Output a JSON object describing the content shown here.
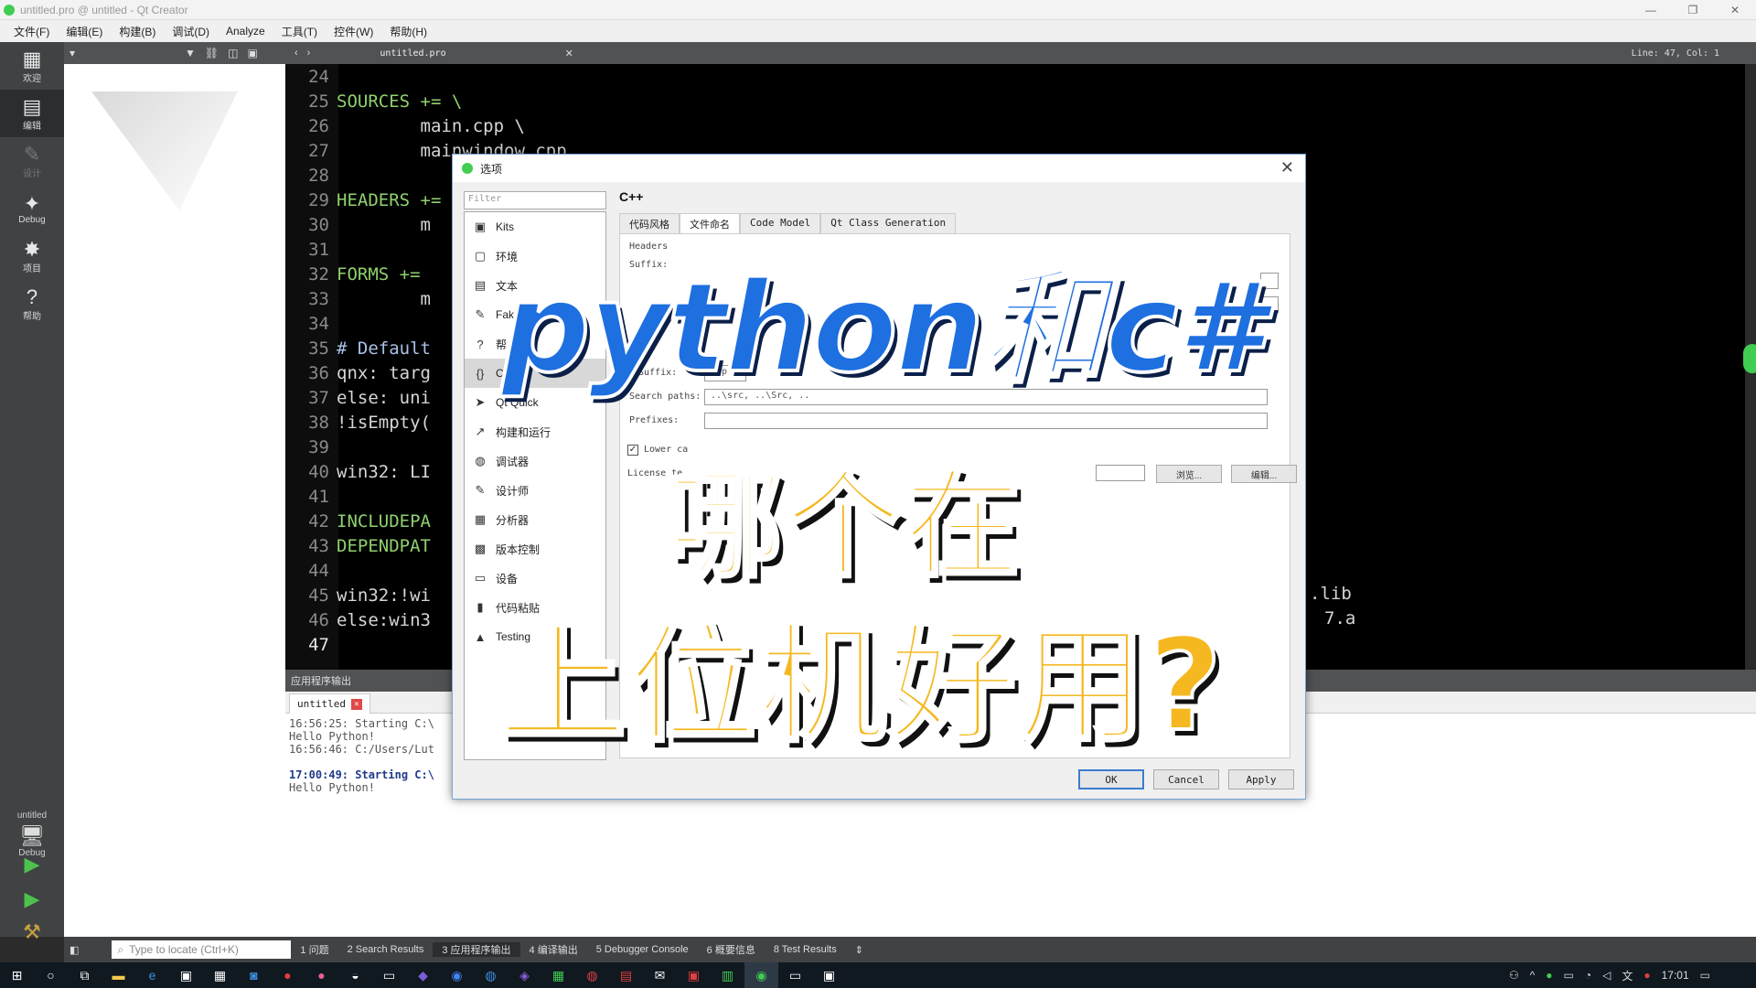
{
  "window": {
    "title": "untitled.pro @ untitled - Qt Creator"
  },
  "menu": [
    "文件(F)",
    "编辑(E)",
    "构建(B)",
    "调试(D)",
    "Analyze",
    "工具(T)",
    "控件(W)",
    "帮助(H)"
  ],
  "modes": [
    {
      "label": "欢迎",
      "icon": "▦"
    },
    {
      "label": "编辑",
      "icon": "▤"
    },
    {
      "label": "设计",
      "icon": "✎"
    },
    {
      "label": "Debug",
      "icon": "✦"
    },
    {
      "label": "项目",
      "icon": "✸"
    },
    {
      "label": "帮助",
      "icon": "?"
    }
  ],
  "kit": {
    "project": "untitled",
    "mode": "Debug"
  },
  "editor": {
    "file_tab": "untitled.pro",
    "cursor": "Line: 47, Col: 1",
    "lines": [
      {
        "n": "24",
        "t": ""
      },
      {
        "n": "25",
        "t": "SOURCES += \\"
      },
      {
        "n": "26",
        "t": "        main.cpp \\"
      },
      {
        "n": "27",
        "t": "        mainwindow.cpp"
      },
      {
        "n": "28",
        "t": ""
      },
      {
        "n": "29",
        "t": "HEADERS +="
      },
      {
        "n": "30",
        "t": "        m"
      },
      {
        "n": "31",
        "t": ""
      },
      {
        "n": "32",
        "t": "FORMS +="
      },
      {
        "n": "33",
        "t": "        m"
      },
      {
        "n": "34",
        "t": ""
      },
      {
        "n": "35",
        "t": "# Default"
      },
      {
        "n": "36",
        "t": "qnx: targ"
      },
      {
        "n": "37",
        "t": "else: uni"
      },
      {
        "n": "38",
        "t": "!isEmpty("
      },
      {
        "n": "39",
        "t": ""
      },
      {
        "n": "40",
        "t": "win32: LI"
      },
      {
        "n": "41",
        "t": ""
      },
      {
        "n": "42",
        "t": "INCLUDEPA"
      },
      {
        "n": "43",
        "t": "DEPENDPAT"
      },
      {
        "n": "44",
        "t": ""
      },
      {
        "n": "45",
        "t": "win32:!wi"
      },
      {
        "n": "46",
        "t": "else:win3"
      },
      {
        "n": "47",
        "t": ""
      }
    ],
    "right_fragments": [
      ".lib",
      "7.a"
    ]
  },
  "output": {
    "header": "应用程序输出",
    "tab": "untitled",
    "lines": [
      {
        "t": "16:56:25: Starting C:\\",
        "bold": false
      },
      {
        "t": "Hello Python!",
        "bold": false
      },
      {
        "t": "16:56:46: C:/Users/Lut",
        "bold": false
      },
      {
        "t": "",
        "bold": false
      },
      {
        "t": "17:00:49: Starting C:\\",
        "bold": true
      },
      {
        "t": "Hello Python!",
        "bold": false
      }
    ]
  },
  "panels": {
    "locate_placeholder": "Type to locate (Ctrl+K)",
    "buttons": [
      "1 问题",
      "2 Search Results",
      "3 应用程序输出",
      "4 编译输出",
      "5 Debugger Console",
      "6 概要信息",
      "8 Test Results"
    ]
  },
  "taskbar": {
    "time": "17:01"
  },
  "dialog": {
    "title": "选项",
    "filter_placeholder": "Filter",
    "heading": "C++",
    "categories": [
      {
        "label": "Kits",
        "icon": "▣"
      },
      {
        "label": "环境",
        "icon": "▢"
      },
      {
        "label": "文本",
        "icon": "▤"
      },
      {
        "label": "Fake",
        "icon": "✎"
      },
      {
        "label": "帮",
        "icon": "?"
      },
      {
        "label": "C",
        "icon": "{}"
      },
      {
        "label": "Qt Quick",
        "icon": "➤"
      },
      {
        "label": "构建和运行",
        "icon": "↗"
      },
      {
        "label": "调试器",
        "icon": "◍"
      },
      {
        "label": "设计师",
        "icon": "✎"
      },
      {
        "label": "分析器",
        "icon": "▦"
      },
      {
        "label": "版本控制",
        "icon": "▩"
      },
      {
        "label": "设备",
        "icon": "▭"
      },
      {
        "label": "代码粘贴",
        "icon": "▮"
      },
      {
        "label": "Testing",
        "icon": "▲"
      }
    ],
    "tabs": [
      "代码风格",
      "文件命名",
      "Code Model",
      "Qt Class Generation"
    ],
    "fields": {
      "headers_group": "Headers",
      "suffix_label": "Suffix:",
      "source_suffix_label": "Suffix:",
      "source_suffix_value": "cpp",
      "search_paths_label": "Search paths:",
      "search_paths_value": "..\\src, ..\\Src, ..",
      "prefixes_label": "Prefixes:",
      "lowercase_label": "Lower ca",
      "license_label": "License te",
      "browse_button": "浏览...",
      "edit_button": "编辑..."
    },
    "buttons": {
      "ok": "OK",
      "cancel": "Cancel",
      "apply": "Apply"
    }
  },
  "headline": {
    "line1": "python和c#",
    "line2": "哪个在",
    "line3": "上位机好用?"
  },
  "colors": {
    "headline_blue": "#1e6fe0",
    "headline_yellow": "#f5b820",
    "qt_green": "#41cd52"
  }
}
